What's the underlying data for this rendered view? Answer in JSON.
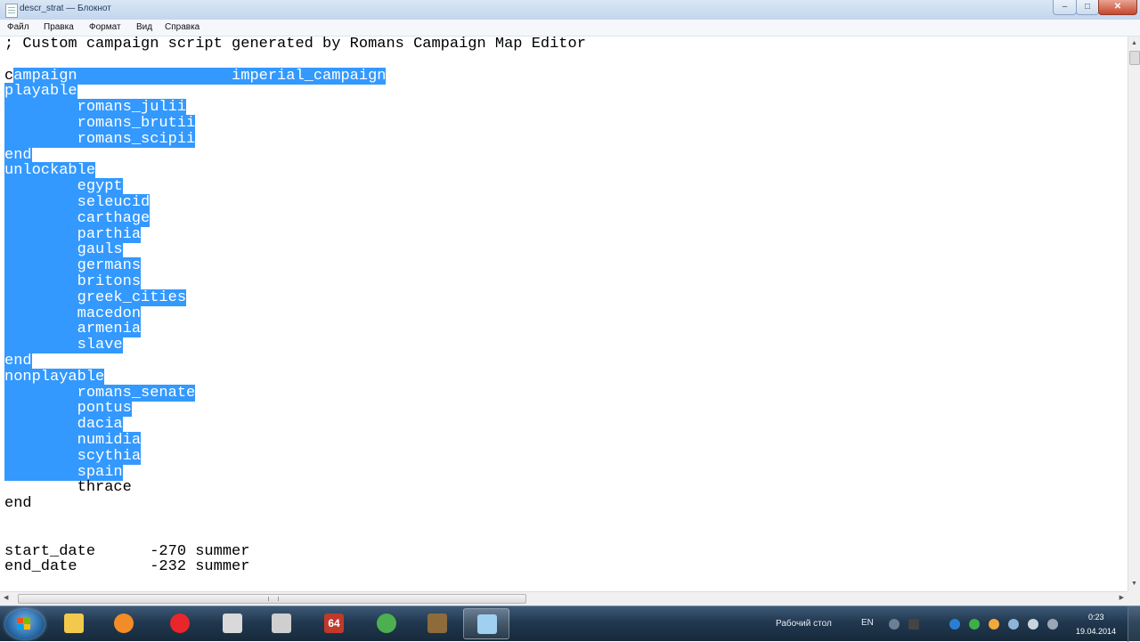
{
  "window": {
    "title": "descr_strat — Блокнот",
    "minimize_glyph": "–",
    "maximize_glyph": "□",
    "close_glyph": "✕"
  },
  "menu": [
    "Файл",
    "Правка",
    "Формат",
    "Вид",
    "Справка"
  ],
  "editor": {
    "lines": [
      {
        "pre": "; Custom campaign script generated by Romans Campaign Map Editor",
        "sel": "",
        "post": ""
      },
      {
        "pre": "",
        "sel": "",
        "post": ""
      },
      {
        "pre": "c",
        "sel": "ampaign                 imperial_campaign",
        "post": ""
      },
      {
        "pre": "",
        "sel": "playable",
        "post": ""
      },
      {
        "pre": "",
        "sel": "        romans_julii",
        "post": ""
      },
      {
        "pre": "",
        "sel": "        romans_brutii",
        "post": ""
      },
      {
        "pre": "",
        "sel": "        romans_scipii",
        "post": ""
      },
      {
        "pre": "",
        "sel": "end",
        "post": ""
      },
      {
        "pre": "",
        "sel": "unlockable",
        "post": ""
      },
      {
        "pre": "",
        "sel": "        egypt",
        "post": ""
      },
      {
        "pre": "",
        "sel": "        seleucid",
        "post": ""
      },
      {
        "pre": "",
        "sel": "        carthage",
        "post": ""
      },
      {
        "pre": "",
        "sel": "        parthia",
        "post": ""
      },
      {
        "pre": "",
        "sel": "        gauls",
        "post": ""
      },
      {
        "pre": "",
        "sel": "        germans",
        "post": ""
      },
      {
        "pre": "",
        "sel": "        britons",
        "post": ""
      },
      {
        "pre": "",
        "sel": "        greek_cities",
        "post": ""
      },
      {
        "pre": "",
        "sel": "        macedon",
        "post": ""
      },
      {
        "pre": "",
        "sel": "        armenia",
        "post": ""
      },
      {
        "pre": "",
        "sel": "        slave",
        "post": ""
      },
      {
        "pre": "",
        "sel": "end",
        "post": ""
      },
      {
        "pre": "",
        "sel": "nonplayable",
        "post": ""
      },
      {
        "pre": "",
        "sel": "        romans_senate",
        "post": ""
      },
      {
        "pre": "",
        "sel": "        pontus",
        "post": ""
      },
      {
        "pre": "",
        "sel": "        dacia",
        "post": ""
      },
      {
        "pre": "",
        "sel": "        numidia",
        "post": ""
      },
      {
        "pre": "",
        "sel": "        scythia",
        "post": ""
      },
      {
        "pre": "",
        "sel": "        spain",
        "post": ""
      },
      {
        "pre": "        thrace",
        "sel": "",
        "post": ""
      },
      {
        "pre": "end",
        "sel": "",
        "post": ""
      },
      {
        "pre": "",
        "sel": "",
        "post": ""
      },
      {
        "pre": "",
        "sel": "",
        "post": ""
      },
      {
        "pre": "start_date      -270 summer",
        "sel": "",
        "post": ""
      },
      {
        "pre": "end_date        -232 summer",
        "sel": "",
        "post": ""
      }
    ]
  },
  "scrollbars": {
    "up_glyph": "▲",
    "down_glyph": "▼",
    "left_glyph": "◀",
    "right_glyph": "▶"
  },
  "taskbar": {
    "apps": [
      {
        "name": "explorer",
        "icon": "folder-icon",
        "color": "#f2c94c"
      },
      {
        "name": "media-player",
        "icon": "media-player-icon",
        "color": "#f28c28"
      },
      {
        "name": "yandex-browser",
        "icon": "yandex-icon",
        "color": "#e8262b"
      },
      {
        "name": "game-launcher",
        "icon": "skull-icon",
        "color": "#d9d9d9"
      },
      {
        "name": "steam-tool",
        "icon": "tool-icon",
        "color": "#cfcfcf"
      },
      {
        "name": "aida64",
        "icon": "aida64-icon",
        "label": "64",
        "color": "#c0392b"
      },
      {
        "name": "chrome",
        "icon": "chrome-icon",
        "color": "#4caf50"
      },
      {
        "name": "archive-tool",
        "icon": "archive-icon",
        "color": "#8e6b3a"
      },
      {
        "name": "notepad",
        "icon": "notepad-icon",
        "color": "#9fd0f2"
      }
    ],
    "desktop_label": "Рабочий стол",
    "lang": "EN",
    "time": "0:23",
    "date": "19.04.2014"
  }
}
